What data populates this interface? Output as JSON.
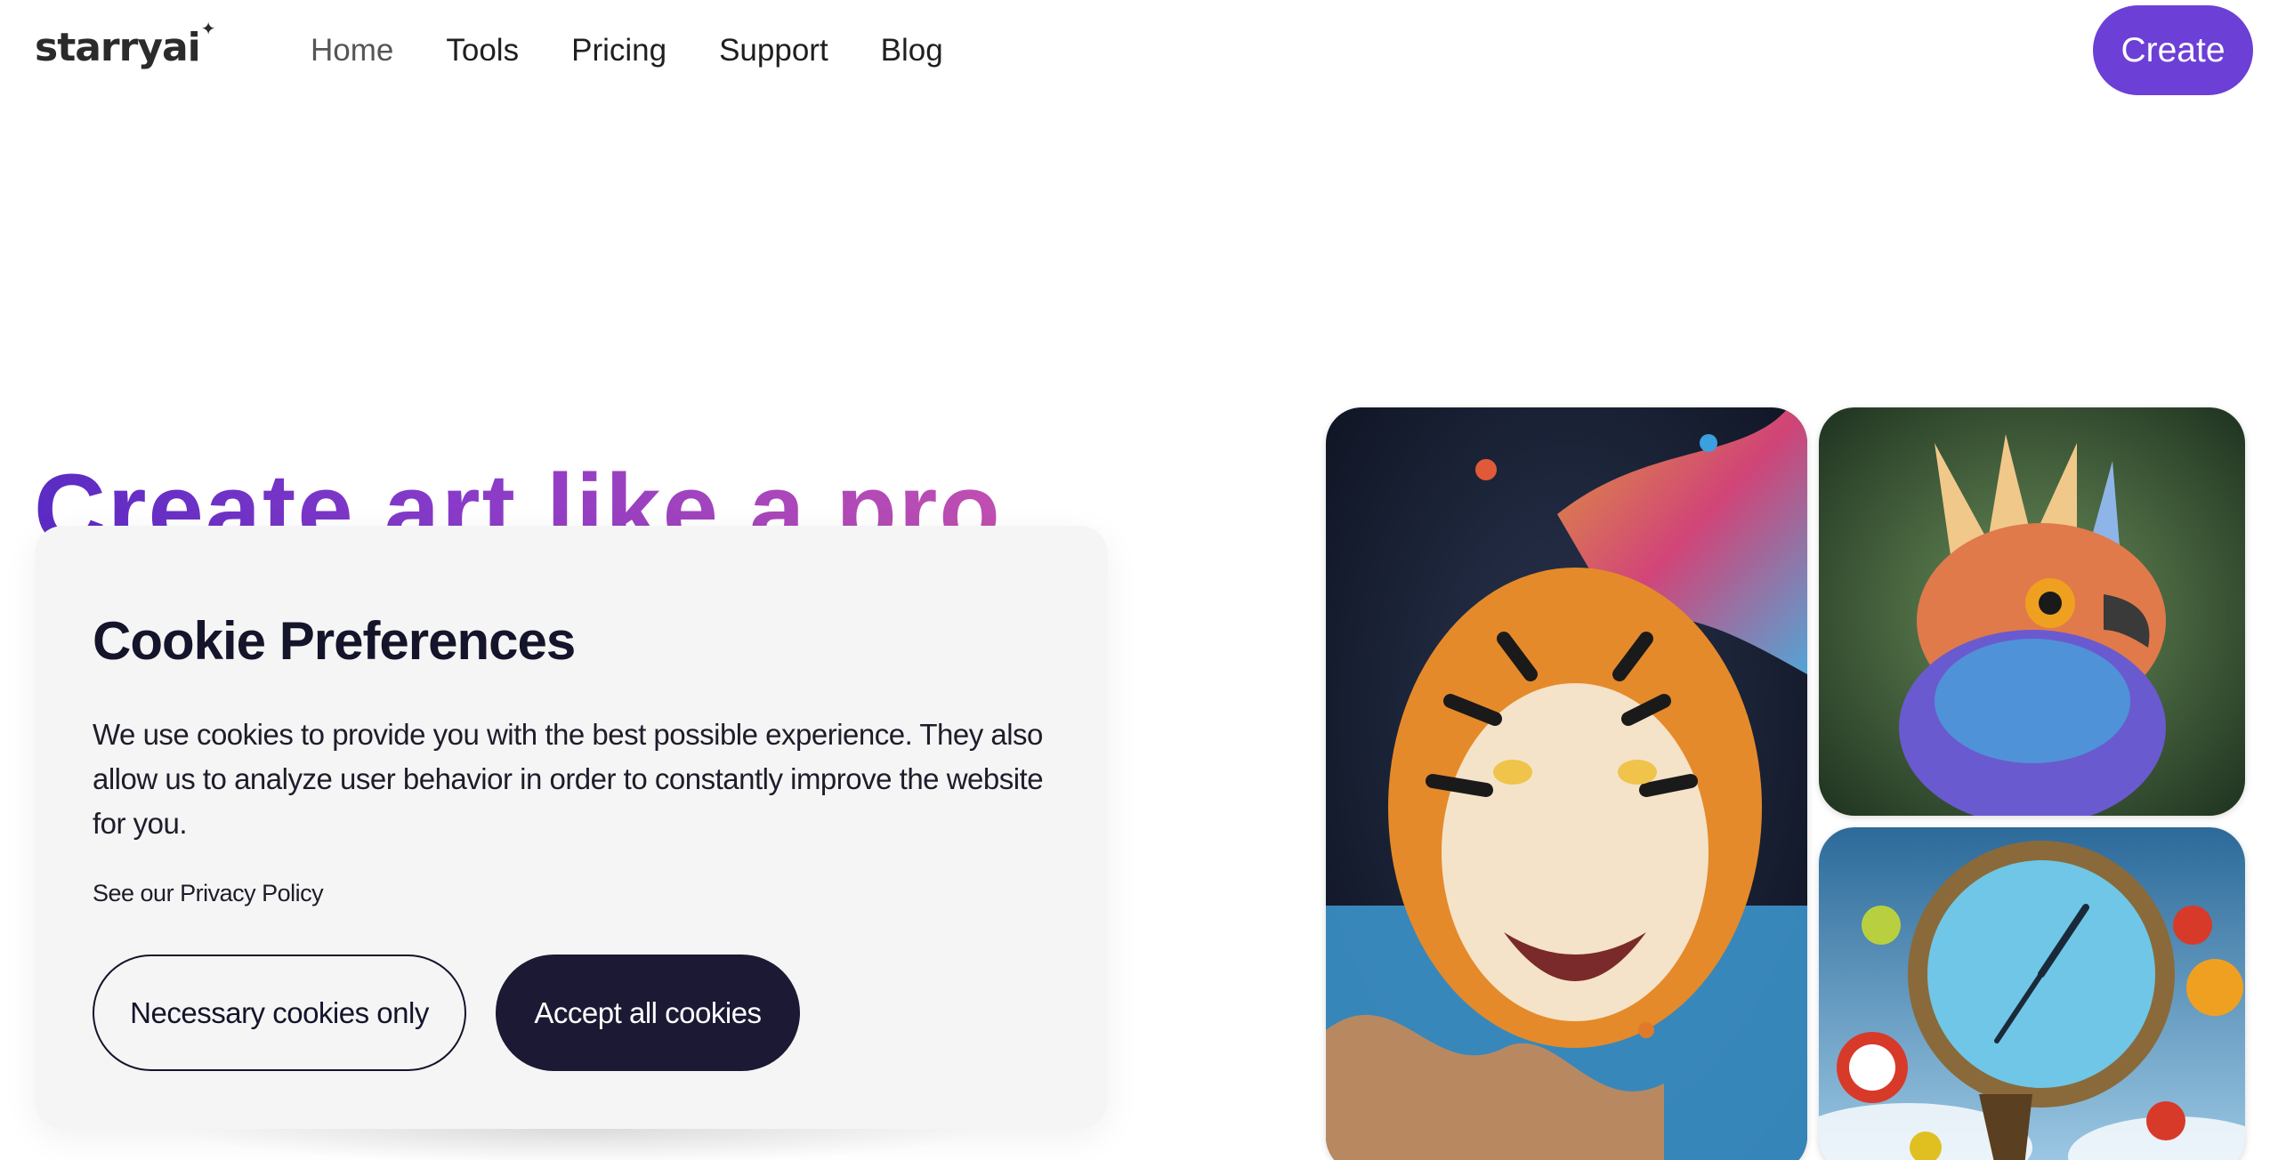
{
  "header": {
    "logo": "starryai",
    "nav": [
      "Home",
      "Tools",
      "Pricing",
      "Support",
      "Blog"
    ],
    "active_nav": "Home",
    "cta_label": "Create"
  },
  "hero": {
    "title": "Create art like a pro"
  },
  "gallery": {
    "images": [
      "tiger-artwork",
      "bird-artwork",
      "clock-artwork"
    ]
  },
  "cookie_modal": {
    "title": "Cookie Preferences",
    "body": "We use cookies to provide you with the best possible experience. They also allow us to analyze user behavior in order to constantly improve the website for you.",
    "policy_prefix": "See our ",
    "policy_link": "Privacy Policy",
    "necessary_label": "Necessary cookies only",
    "accept_label": "Accept all cookies"
  },
  "colors": {
    "brand_purple": "#6c3fd6",
    "dark_button": "#1b1934",
    "modal_bg": "#f5f5f5"
  }
}
